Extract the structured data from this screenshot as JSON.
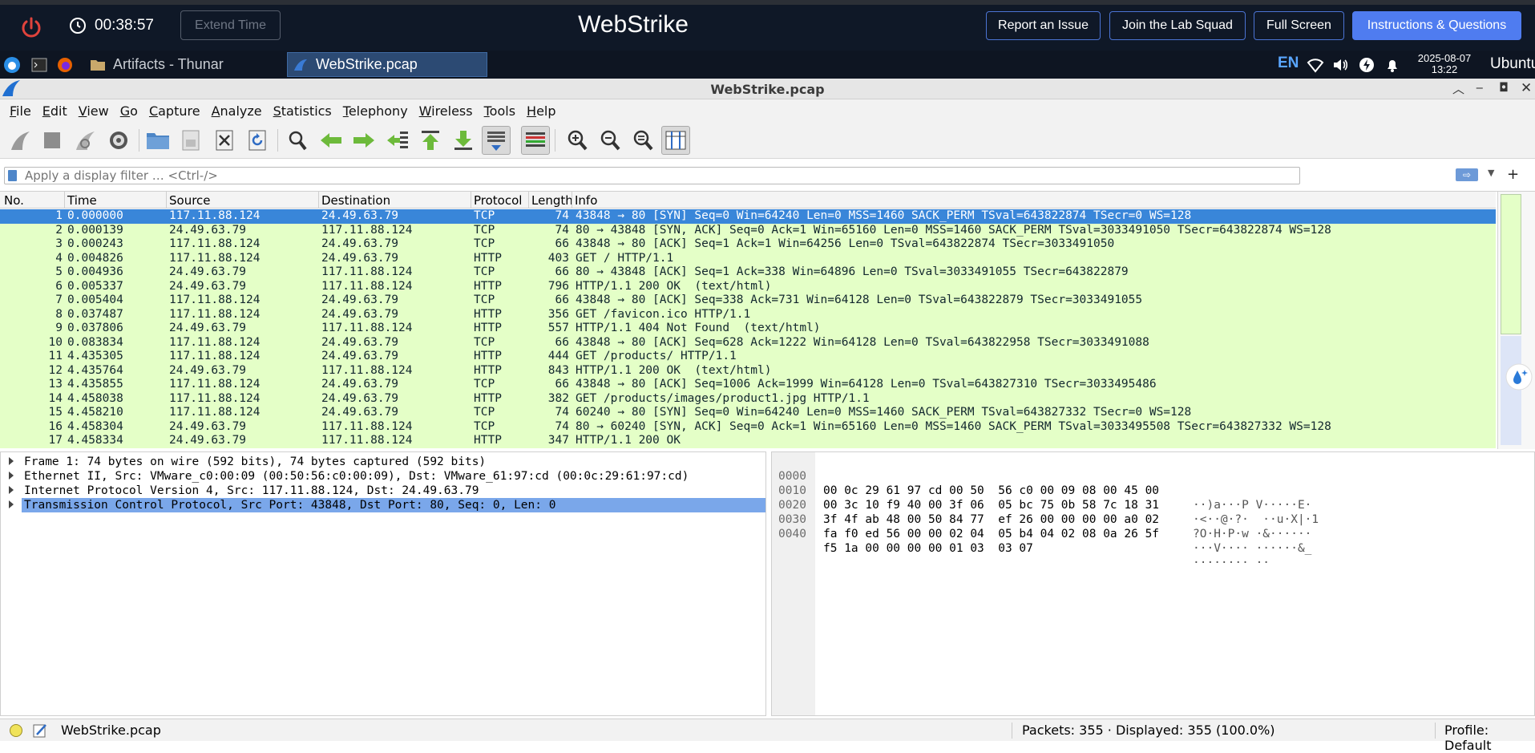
{
  "lab": {
    "timer": "00:38:57",
    "extend_label": "Extend Time",
    "title": "WebStrike",
    "report_label": "Report an Issue",
    "squad_label": "Join the Lab Squad",
    "fullscreen_label": "Full Screen",
    "instructions_label": "Instructions & Questions"
  },
  "panel": {
    "tasks": [
      {
        "label": "Artifacts - Thunar",
        "icon": "folder-icon"
      },
      {
        "label": "WebStrike.pcap",
        "icon": "wireshark-icon"
      }
    ],
    "lang": "EN",
    "date": "2025-08-07",
    "time": "13:22",
    "user": "Ubuntu"
  },
  "window": {
    "title": "WebStrike.pcap"
  },
  "menu": [
    "File",
    "Edit",
    "View",
    "Go",
    "Capture",
    "Analyze",
    "Statistics",
    "Telephony",
    "Wireless",
    "Tools",
    "Help"
  ],
  "filter": {
    "placeholder": "Apply a display filter … <Ctrl-/>"
  },
  "packet_list": {
    "columns": [
      "No.",
      "Time",
      "Source",
      "Destination",
      "Protocol",
      "Length",
      "Info"
    ],
    "rows": [
      {
        "no": "1",
        "time": "0.000000",
        "src": "117.11.88.124",
        "dst": "24.49.63.79",
        "proto": "TCP",
        "len": "74",
        "info": "43848 → 80 [SYN] Seq=0 Win=64240 Len=0 MSS=1460 SACK_PERM TSval=643822874 TSecr=0 WS=128"
      },
      {
        "no": "2",
        "time": "0.000139",
        "src": "24.49.63.79",
        "dst": "117.11.88.124",
        "proto": "TCP",
        "len": "74",
        "info": "80 → 43848 [SYN, ACK] Seq=0 Ack=1 Win=65160 Len=0 MSS=1460 SACK_PERM TSval=3033491050 TSecr=643822874 WS=128"
      },
      {
        "no": "3",
        "time": "0.000243",
        "src": "117.11.88.124",
        "dst": "24.49.63.79",
        "proto": "TCP",
        "len": "66",
        "info": "43848 → 80 [ACK] Seq=1 Ack=1 Win=64256 Len=0 TSval=643822874 TSecr=3033491050"
      },
      {
        "no": "4",
        "time": "0.004826",
        "src": "117.11.88.124",
        "dst": "24.49.63.79",
        "proto": "HTTP",
        "len": "403",
        "info": "GET / HTTP/1.1"
      },
      {
        "no": "5",
        "time": "0.004936",
        "src": "24.49.63.79",
        "dst": "117.11.88.124",
        "proto": "TCP",
        "len": "66",
        "info": "80 → 43848 [ACK] Seq=1 Ack=338 Win=64896 Len=0 TSval=3033491055 TSecr=643822879"
      },
      {
        "no": "6",
        "time": "0.005337",
        "src": "24.49.63.79",
        "dst": "117.11.88.124",
        "proto": "HTTP",
        "len": "796",
        "info": "HTTP/1.1 200 OK  (text/html)"
      },
      {
        "no": "7",
        "time": "0.005404",
        "src": "117.11.88.124",
        "dst": "24.49.63.79",
        "proto": "TCP",
        "len": "66",
        "info": "43848 → 80 [ACK] Seq=338 Ack=731 Win=64128 Len=0 TSval=643822879 TSecr=3033491055"
      },
      {
        "no": "8",
        "time": "0.037487",
        "src": "117.11.88.124",
        "dst": "24.49.63.79",
        "proto": "HTTP",
        "len": "356",
        "info": "GET /favicon.ico HTTP/1.1"
      },
      {
        "no": "9",
        "time": "0.037806",
        "src": "24.49.63.79",
        "dst": "117.11.88.124",
        "proto": "HTTP",
        "len": "557",
        "info": "HTTP/1.1 404 Not Found  (text/html)"
      },
      {
        "no": "10",
        "time": "0.083834",
        "src": "117.11.88.124",
        "dst": "24.49.63.79",
        "proto": "TCP",
        "len": "66",
        "info": "43848 → 80 [ACK] Seq=628 Ack=1222 Win=64128 Len=0 TSval=643822958 TSecr=3033491088"
      },
      {
        "no": "11",
        "time": "4.435305",
        "src": "117.11.88.124",
        "dst": "24.49.63.79",
        "proto": "HTTP",
        "len": "444",
        "info": "GET /products/ HTTP/1.1"
      },
      {
        "no": "12",
        "time": "4.435764",
        "src": "24.49.63.79",
        "dst": "117.11.88.124",
        "proto": "HTTP",
        "len": "843",
        "info": "HTTP/1.1 200 OK  (text/html)"
      },
      {
        "no": "13",
        "time": "4.435855",
        "src": "117.11.88.124",
        "dst": "24.49.63.79",
        "proto": "TCP",
        "len": "66",
        "info": "43848 → 80 [ACK] Seq=1006 Ack=1999 Win=64128 Len=0 TSval=643827310 TSecr=3033495486"
      },
      {
        "no": "14",
        "time": "4.458038",
        "src": "117.11.88.124",
        "dst": "24.49.63.79",
        "proto": "HTTP",
        "len": "382",
        "info": "GET /products/images/product1.jpg HTTP/1.1"
      },
      {
        "no": "15",
        "time": "4.458210",
        "src": "117.11.88.124",
        "dst": "24.49.63.79",
        "proto": "TCP",
        "len": "74",
        "info": "60240 → 80 [SYN] Seq=0 Win=64240 Len=0 MSS=1460 SACK_PERM TSval=643827332 TSecr=0 WS=128"
      },
      {
        "no": "16",
        "time": "4.458304",
        "src": "24.49.63.79",
        "dst": "117.11.88.124",
        "proto": "TCP",
        "len": "74",
        "info": "80 → 60240 [SYN, ACK] Seq=0 Ack=1 Win=65160 Len=0 MSS=1460 SACK_PERM TSval=3033495508 TSecr=643827332 WS=128"
      },
      {
        "no": "17",
        "time": "4.458334",
        "src": "24.49.63.79",
        "dst": "117.11.88.124",
        "proto": "HTTP",
        "len": "347",
        "info": "HTTP/1.1 200 OK"
      }
    ]
  },
  "details": [
    "Frame 1: 74 bytes on wire (592 bits), 74 bytes captured (592 bits)",
    "Ethernet II, Src: VMware_c0:00:09 (00:50:56:c0:00:09), Dst: VMware_61:97:cd (00:0c:29:61:97:cd)",
    "Internet Protocol Version 4, Src: 117.11.88.124, Dst: 24.49.63.79",
    "Transmission Control Protocol, Src Port: 43848, Dst Port: 80, Seq: 0, Len: 0"
  ],
  "bytes": [
    {
      "off": "0000",
      "hex": "00 0c 29 61 97 cd 00 50  56 c0 00 09 08 00 45 00",
      "ascii": "··)a···P V·····E·"
    },
    {
      "off": "0010",
      "hex": "00 3c 10 f9 40 00 3f 06  05 bc 75 0b 58 7c 18 31",
      "ascii": "·<··@·?·  ··u·X|·1"
    },
    {
      "off": "0020",
      "hex": "3f 4f ab 48 00 50 84 77  ef 26 00 00 00 00 a0 02",
      "ascii": "?O·H·P·w ·&······"
    },
    {
      "off": "0030",
      "hex": "fa f0 ed 56 00 00 02 04  05 b4 04 02 08 0a 26 5f",
      "ascii": "···V···· ······&_"
    },
    {
      "off": "0040",
      "hex": "f5 1a 00 00 00 00 01 03  03 07",
      "ascii": "········ ··"
    }
  ],
  "status": {
    "file": "WebStrike.pcap",
    "packets": "Packets: 355 · Displayed: 355 (100.0%)",
    "profile": "Profile: Default"
  }
}
